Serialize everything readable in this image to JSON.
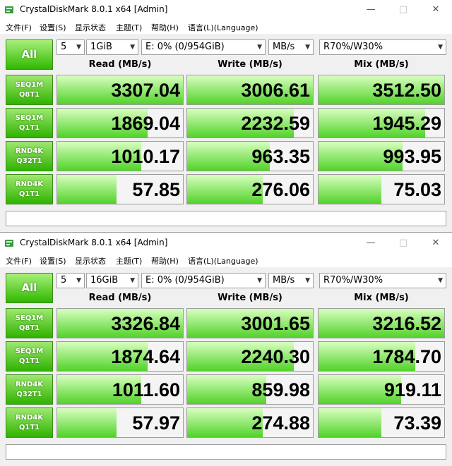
{
  "windows": [
    {
      "title": "CrystalDiskMark 8.0.1 x64 [Admin]",
      "menu": [
        "文件(F)",
        "设置(S)",
        "显示状态",
        "主题(T)",
        "帮助(H)",
        "语言(L)(Language)"
      ],
      "all_label": "All",
      "count": "5",
      "size": "1GiB",
      "drive": "E: 0% (0/954GiB)",
      "unit": "MB/s",
      "mix_ratio": "R70%/W30%",
      "headers": {
        "read": "Read (MB/s)",
        "write": "Write (MB/s)",
        "mix": "Mix (MB/s)"
      },
      "rows": [
        {
          "name1": "SEQ1M",
          "name2": "Q8T1",
          "read": "3307.04",
          "write": "3006.61",
          "mix": "3512.50",
          "read_fill": 1.0,
          "write_fill": 1.0,
          "mix_fill": 1.0
        },
        {
          "name1": "SEQ1M",
          "name2": "Q1T1",
          "read": "1869.04",
          "write": "2232.59",
          "mix": "1945.29",
          "read_fill": 0.72,
          "write_fill": 0.85,
          "mix_fill": 0.85
        },
        {
          "name1": "RND4K",
          "name2": "Q32T1",
          "read": "1010.17",
          "write": "963.35",
          "mix": "993.95",
          "read_fill": 0.67,
          "write_fill": 0.66,
          "mix_fill": 0.67
        },
        {
          "name1": "RND4K",
          "name2": "Q1T1",
          "read": "57.85",
          "write": "276.06",
          "mix": "75.03",
          "read_fill": 0.47,
          "write_fill": 0.6,
          "mix_fill": 0.5
        }
      ]
    },
    {
      "title": "CrystalDiskMark 8.0.1 x64 [Admin]",
      "menu": [
        "文件(F)",
        "设置(S)",
        "显示状态",
        "主题(T)",
        "帮助(H)",
        "语言(L)(Language)"
      ],
      "all_label": "All",
      "count": "5",
      "size": "16GiB",
      "drive": "E: 0% (0/954GiB)",
      "unit": "MB/s",
      "mix_ratio": "R70%/W30%",
      "headers": {
        "read": "Read (MB/s)",
        "write": "Write (MB/s)",
        "mix": "Mix (MB/s)"
      },
      "rows": [
        {
          "name1": "SEQ1M",
          "name2": "Q8T1",
          "read": "3326.84",
          "write": "3001.65",
          "mix": "3216.52",
          "read_fill": 1.0,
          "write_fill": 1.0,
          "mix_fill": 1.0
        },
        {
          "name1": "SEQ1M",
          "name2": "Q1T1",
          "read": "1874.64",
          "write": "2240.30",
          "mix": "1784.70",
          "read_fill": 0.72,
          "write_fill": 0.85,
          "mix_fill": 0.77
        },
        {
          "name1": "RND4K",
          "name2": "Q32T1",
          "read": "1011.60",
          "write": "859.98",
          "mix": "919.11",
          "read_fill": 0.67,
          "write_fill": 0.63,
          "mix_fill": 0.66
        },
        {
          "name1": "RND4K",
          "name2": "Q1T1",
          "read": "57.97",
          "write": "274.88",
          "mix": "73.39",
          "read_fill": 0.47,
          "write_fill": 0.6,
          "mix_fill": 0.5
        }
      ]
    }
  ],
  "colors": {
    "bar_light": "#d8ffc0",
    "bar_dark": "#52d22a",
    "button_green": "#30b800"
  }
}
